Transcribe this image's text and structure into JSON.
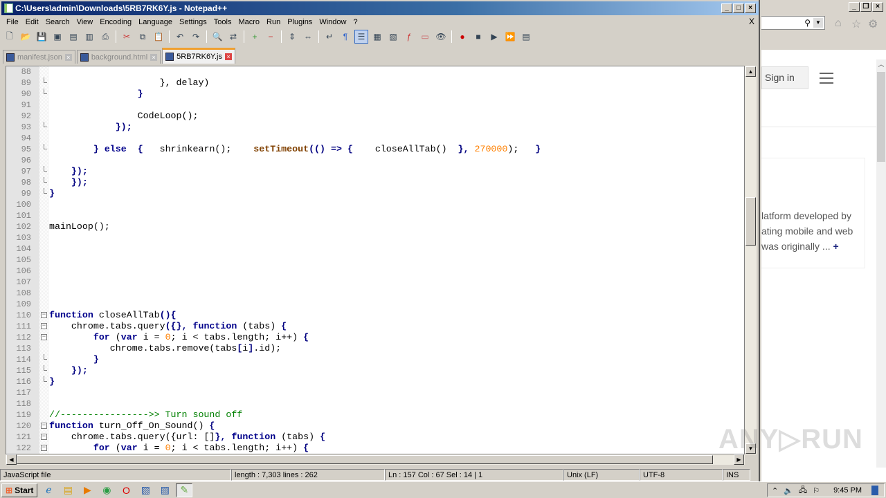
{
  "window": {
    "title": "C:\\Users\\admin\\Downloads\\5RB7RK6Y.js - Notepad++",
    "close_doc": "X"
  },
  "menu": [
    "File",
    "Edit",
    "Search",
    "View",
    "Encoding",
    "Language",
    "Settings",
    "Tools",
    "Macro",
    "Run",
    "Plugins",
    "Window",
    "?"
  ],
  "tabs": [
    {
      "label": "manifest.json",
      "active": false
    },
    {
      "label": "background.html",
      "active": false
    },
    {
      "label": "5RB7RK6Y.js",
      "active": true
    }
  ],
  "code": [
    {
      "n": "88",
      "fold": "",
      "t": []
    },
    {
      "n": "89",
      "fold": "tick",
      "t": [
        [
          "                    ",
          ""
        ],
        [
          "}",
          ""
        ],
        [
          ", delay)",
          ""
        ]
      ]
    },
    {
      "n": "90",
      "fold": "tick",
      "t": [
        [
          "                ",
          ""
        ],
        [
          "}",
          "op"
        ]
      ]
    },
    {
      "n": "91",
      "fold": "",
      "t": []
    },
    {
      "n": "92",
      "fold": "",
      "t": [
        [
          "                CodeLoop();",
          ""
        ]
      ]
    },
    {
      "n": "93",
      "fold": "tick",
      "t": [
        [
          "            ",
          ""
        ],
        [
          "});",
          "op"
        ]
      ]
    },
    {
      "n": "94",
      "fold": "",
      "t": []
    },
    {
      "n": "95",
      "fold": "tick",
      "t": [
        [
          "        ",
          ""
        ],
        [
          "} ",
          "op"
        ],
        [
          "else",
          "kw"
        ],
        [
          "  ",
          ""
        ],
        [
          "{",
          "op"
        ],
        [
          "   shrinkearn();    ",
          ""
        ],
        [
          "setTimeout",
          "fn"
        ],
        [
          "(() => {",
          "op"
        ],
        [
          "    closeAllTab()  ",
          ""
        ],
        [
          "},",
          "op"
        ],
        [
          " ",
          ""
        ],
        [
          "270000",
          "num"
        ],
        [
          ");   ",
          ""
        ],
        [
          "}",
          "op"
        ]
      ]
    },
    {
      "n": "96",
      "fold": "",
      "t": []
    },
    {
      "n": "97",
      "fold": "tick",
      "t": [
        [
          "    ",
          ""
        ],
        [
          "});",
          "op"
        ]
      ]
    },
    {
      "n": "98",
      "fold": "tick",
      "t": [
        [
          "    ",
          ""
        ],
        [
          "});",
          "op"
        ]
      ]
    },
    {
      "n": "99",
      "fold": "end",
      "t": [
        [
          "}",
          "op"
        ]
      ]
    },
    {
      "n": "100",
      "fold": "",
      "t": []
    },
    {
      "n": "101",
      "fold": "",
      "t": []
    },
    {
      "n": "102",
      "fold": "",
      "t": [
        [
          "mainLoop();",
          ""
        ]
      ]
    },
    {
      "n": "103",
      "fold": "",
      "t": []
    },
    {
      "n": "104",
      "fold": "",
      "t": []
    },
    {
      "n": "105",
      "fold": "",
      "t": []
    },
    {
      "n": "106",
      "fold": "",
      "t": []
    },
    {
      "n": "107",
      "fold": "",
      "t": []
    },
    {
      "n": "108",
      "fold": "",
      "t": []
    },
    {
      "n": "109",
      "fold": "",
      "t": []
    },
    {
      "n": "110",
      "fold": "box",
      "t": [
        [
          "function",
          "kw"
        ],
        [
          " closeAllTab",
          ""
        ],
        [
          "(){",
          "op"
        ]
      ]
    },
    {
      "n": "111",
      "fold": "box",
      "t": [
        [
          "    chrome.tabs.query",
          ""
        ],
        [
          "({},",
          "op"
        ],
        [
          " ",
          ""
        ],
        [
          "function",
          "kw"
        ],
        [
          " (tabs) ",
          ""
        ],
        [
          "{",
          "op"
        ]
      ]
    },
    {
      "n": "112",
      "fold": "box",
      "t": [
        [
          "        ",
          ""
        ],
        [
          "for",
          "kw"
        ],
        [
          " (",
          ""
        ],
        [
          "var",
          "kw"
        ],
        [
          " i = ",
          ""
        ],
        [
          "0",
          "num"
        ],
        [
          "; i < tabs.length; i++) ",
          ""
        ],
        [
          "{",
          "op"
        ]
      ]
    },
    {
      "n": "113",
      "fold": "",
      "t": [
        [
          "           chrome.tabs.remove(tabs",
          ""
        ],
        [
          "[",
          "op"
        ],
        [
          "i",
          ""
        ],
        [
          "]",
          "op"
        ],
        [
          ".id);",
          ""
        ]
      ]
    },
    {
      "n": "114",
      "fold": "tick",
      "t": [
        [
          "        ",
          ""
        ],
        [
          "}",
          "op"
        ]
      ]
    },
    {
      "n": "115",
      "fold": "tick",
      "t": [
        [
          "    ",
          ""
        ],
        [
          "});",
          "op"
        ]
      ]
    },
    {
      "n": "116",
      "fold": "end",
      "t": [
        [
          "}",
          "op"
        ]
      ]
    },
    {
      "n": "117",
      "fold": "",
      "t": []
    },
    {
      "n": "118",
      "fold": "",
      "t": []
    },
    {
      "n": "119",
      "fold": "",
      "t": [
        [
          "//---------------->> Turn sound off",
          "cm"
        ]
      ]
    },
    {
      "n": "120",
      "fold": "box",
      "t": [
        [
          "function",
          "kw"
        ],
        [
          " turn_Off_On_Sound() ",
          ""
        ],
        [
          "{",
          "op"
        ]
      ]
    },
    {
      "n": "121",
      "fold": "box",
      "t": [
        [
          "    chrome.tabs.query",
          ""
        ],
        [
          "({",
          ""
        ],
        [
          "url: ",
          ""
        ],
        [
          "[]",
          ""
        ],
        [
          "},",
          "op"
        ],
        [
          " ",
          ""
        ],
        [
          "function",
          "kw"
        ],
        [
          " (tabs) ",
          ""
        ],
        [
          "{",
          "op"
        ]
      ]
    },
    {
      "n": "122",
      "fold": "box",
      "t": [
        [
          "        ",
          ""
        ],
        [
          "for",
          "kw"
        ],
        [
          " (",
          ""
        ],
        [
          "var",
          "kw"
        ],
        [
          " i = ",
          ""
        ],
        [
          "0",
          "num"
        ],
        [
          "; i < tabs.length; i++) ",
          ""
        ],
        [
          "{",
          "op"
        ]
      ]
    }
  ],
  "status": {
    "type": "JavaScript file",
    "length": "length : 7,303    lines : 262",
    "pos": "Ln : 157    Col : 67    Sel : 14 | 1",
    "eol": "Unix (LF)",
    "encoding": "UTF-8",
    "mode": "INS"
  },
  "browser": {
    "sign_in": "Sign in",
    "snippet": [
      "latform developed by",
      "ating mobile and web",
      "was originally ..."
    ],
    "more": "+"
  },
  "taskbar": {
    "start": "Start",
    "time": "9:45 PM"
  },
  "watermark": "ANY.RUN"
}
